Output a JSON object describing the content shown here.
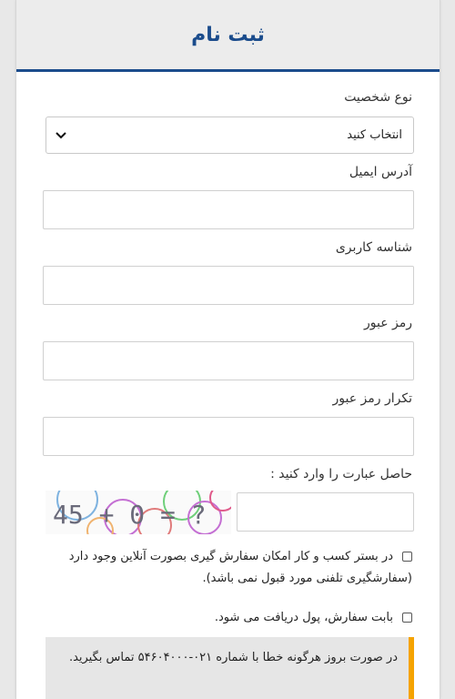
{
  "header": {
    "title": "ثبت نام"
  },
  "form": {
    "person_type_label": "نوع شخصیت",
    "person_type_selected": "انتخاب کنید",
    "email_label": "آدرس ایمیل",
    "username_label": "شناسه کاربری",
    "password_label": "رمز عبور",
    "password_repeat_label": "تکرار رمز عبور",
    "captcha_label": "حاصل عبارت را وارد کنید :",
    "captcha_text": "45 + 0 = ?"
  },
  "checkboxes": [
    {
      "label": "در بستر کسب و کار امکان سفارش گیری بصورت آنلاین وجود دارد (سفارشگیری تلفنی مورد قبول نمی باشد)."
    },
    {
      "label": "بابت سفارش، پول دریافت می شود."
    }
  ],
  "notice": {
    "text": "در صورت بروز هرگونه خطا با شماره ۰۲۱-۵۴۶۰۴۰۰۰ تماس بگیرید."
  },
  "colors": {
    "brand_blue": "#1b4c8c",
    "notice_accent": "#f5a300",
    "header_bg": "#ececec"
  },
  "icons": {
    "select_arrow": "chevron-down-icon"
  }
}
